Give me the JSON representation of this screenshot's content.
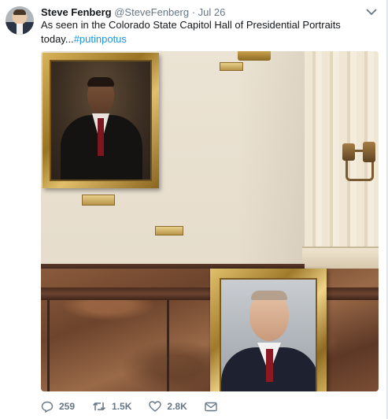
{
  "tweet": {
    "author_name": "Steve Fenberg",
    "author_handle": "@SteveFenberg",
    "separator": "·",
    "time": "Jul 26",
    "text": "As seen in the Colorado State Capitol Hall of Presidential Portraits today...",
    "hashtag": "#putinpotus"
  },
  "actions": {
    "replies": "259",
    "retweets": "1.5K",
    "likes": "2.8K"
  },
  "icons": {
    "reply": "reply-icon",
    "retweet": "retweet-icon",
    "like": "heart-icon",
    "dm": "envelope-icon",
    "menu": "chevron-down-icon"
  },
  "colors": {
    "link": "#1b95e0",
    "muted": "#657786",
    "text": "#14171a"
  }
}
